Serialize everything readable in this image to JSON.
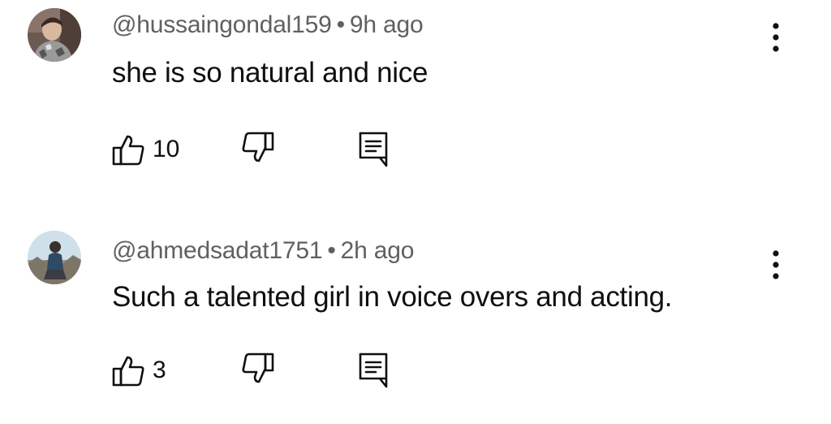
{
  "comments": [
    {
      "username": "@hussaingondal159",
      "separator": "•",
      "time": "9h ago",
      "text": "she is so natural and nice",
      "likes": "10",
      "avatar_icon": "user-avatar-photo"
    },
    {
      "username": "@ahmedsadat1751",
      "separator": "•",
      "time": "2h ago",
      "text": "Such a talented girl in voice overs and acting.",
      "likes": "3",
      "avatar_icon": "user-avatar-photo"
    }
  ],
  "icons": {
    "like": "thumbs-up-icon",
    "dislike": "thumbs-down-icon",
    "reply": "reply-comment-icon",
    "menu": "more-vertical-icon"
  },
  "colors": {
    "text_primary": "#0f0f0f",
    "text_secondary": "#606060",
    "background": "#ffffff"
  }
}
